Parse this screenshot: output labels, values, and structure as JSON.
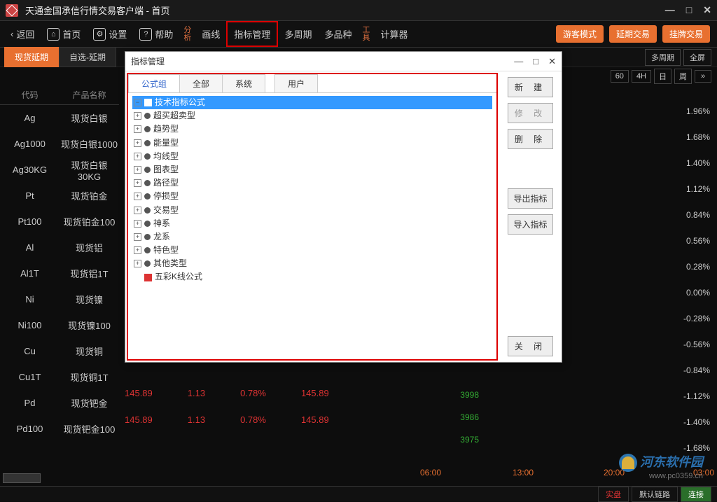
{
  "titlebar": {
    "title": "天通金国承信行情交易客户端 - 首页"
  },
  "navbar": {
    "back": "返回",
    "home": "首页",
    "settings": "设置",
    "help": "帮助",
    "analysis": "分\n析",
    "line": "画线",
    "indicator_mgmt": "指标管理",
    "multi_period": "多周期",
    "multi_variety": "多品种",
    "tools": "工\n具",
    "calculator": "计算器",
    "guest_mode": "游客模式",
    "deferred_trade": "延期交易",
    "listing_trade": "挂牌交易"
  },
  "tabs": {
    "spot_deferred": "现货延期",
    "self_deferred": "自选-延期",
    "multi_period": "多周期",
    "fullscreen": "全屏"
  },
  "periods": [
    "60",
    "4H",
    "日",
    "周",
    "»"
  ],
  "table_header": {
    "code": "代码",
    "name": "产品名称"
  },
  "products": [
    {
      "code": "Ag",
      "name": "现货白银"
    },
    {
      "code": "Ag1000",
      "name": "现货白银1000"
    },
    {
      "code": "Ag30KG",
      "name": "现货白银30KG"
    },
    {
      "code": "Pt",
      "name": "现货铂金"
    },
    {
      "code": "Pt100",
      "name": "现货铂金100"
    },
    {
      "code": "Al",
      "name": "现货铝"
    },
    {
      "code": "Al1T",
      "name": "现货铝1T"
    },
    {
      "code": "Ni",
      "name": "现货镍"
    },
    {
      "code": "Ni100",
      "name": "现货镍100"
    },
    {
      "code": "Cu",
      "name": "现货铜"
    },
    {
      "code": "Cu1T",
      "name": "现货铜1T"
    },
    {
      "code": "Pd",
      "name": "现货钯金"
    },
    {
      "code": "Pd100",
      "name": "现货钯金100"
    }
  ],
  "data_rows": [
    {
      "v1": "145.89",
      "v2": "1.13",
      "v3": "0.78%",
      "v4": "145.89"
    },
    {
      "v1": "145.89",
      "v2": "1.13",
      "v3": "0.78%",
      "v4": "145.89"
    }
  ],
  "pct_values": [
    {
      "v": "1.96%",
      "c": "r"
    },
    {
      "v": "1.68%",
      "c": "r"
    },
    {
      "v": "1.40%",
      "c": "r"
    },
    {
      "v": "1.12%",
      "c": "r"
    },
    {
      "v": "0.84%",
      "c": "r"
    },
    {
      "v": "0.56%",
      "c": "r"
    },
    {
      "v": "0.28%",
      "c": "r"
    },
    {
      "v": "0.00%",
      "c": "w"
    },
    {
      "v": "-0.28%",
      "c": "g"
    },
    {
      "v": "-0.56%",
      "c": "g"
    },
    {
      "v": "-0.84%",
      "c": "g"
    },
    {
      "v": "-1.12%",
      "c": "g"
    },
    {
      "v": "-1.40%",
      "c": "g"
    },
    {
      "v": "-1.68%",
      "c": "g"
    }
  ],
  "y_ticks": [
    "3998",
    "3986",
    "3975"
  ],
  "x_ticks": [
    "06:00",
    "13:00",
    "20:00",
    "03:00"
  ],
  "statusbar": {
    "live": "实盘",
    "link": "默认链路",
    "conn": "连接"
  },
  "watermark": {
    "name": "河东软件园",
    "url": "www.pc0359.cn"
  },
  "dialog": {
    "title": "指标管理",
    "tabs": {
      "formula": "公式组",
      "all": "全部",
      "system": "系统",
      "user": "用户"
    },
    "tree_root": "技术指标公式",
    "tree_items": [
      "超买超卖型",
      "趋势型",
      "能量型",
      "均线型",
      "图表型",
      "路径型",
      "停损型",
      "交易型",
      "神系",
      "龙系",
      "特色型",
      "其他类型"
    ],
    "tree_last": "五彩K线公式",
    "buttons": {
      "new": "新 建",
      "edit": "修 改",
      "delete": "删 除",
      "export": "导出指标",
      "import": "导入指标",
      "close": "关 闭"
    }
  }
}
